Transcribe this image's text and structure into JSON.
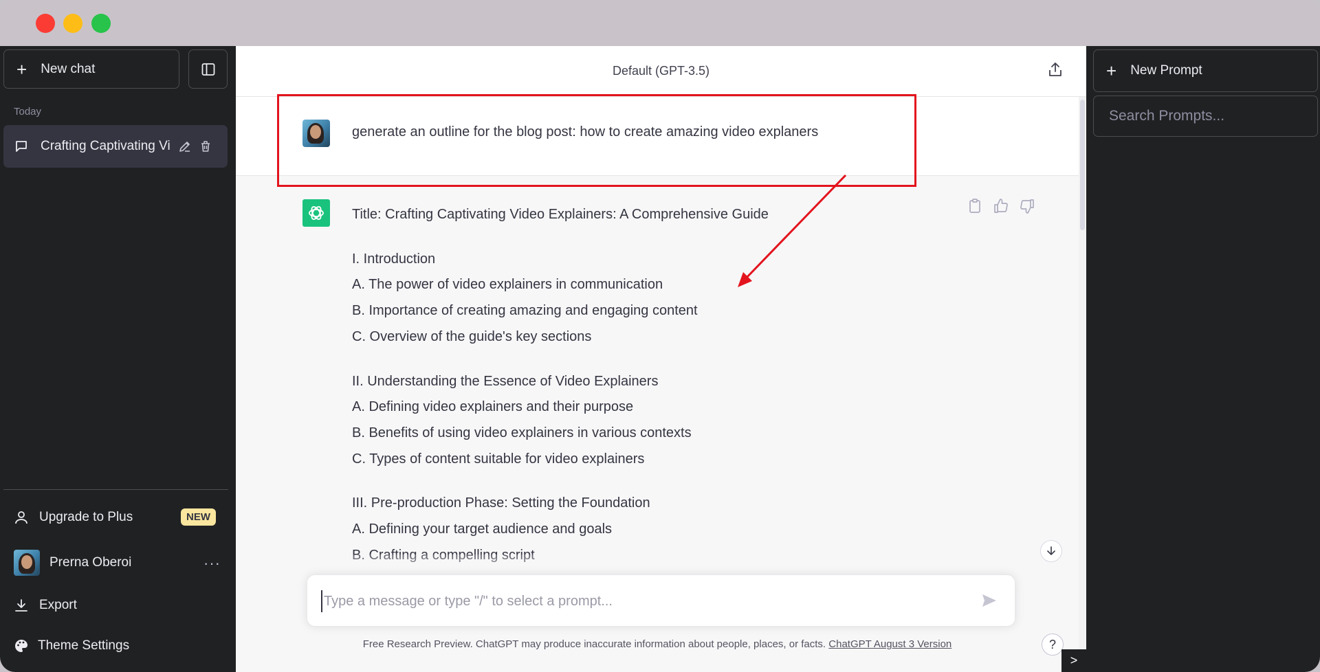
{
  "window": {
    "traffic_lights": [
      "close",
      "minimize",
      "maximize"
    ]
  },
  "sidebar": {
    "new_chat_label": "New chat",
    "section_today": "Today",
    "chat_items": [
      {
        "label": "Crafting Captivating Vi"
      }
    ],
    "upgrade_label": "Upgrade to Plus",
    "new_badge": "NEW",
    "user_name": "Prerna Oberoi",
    "more_label": "···",
    "export_label": "Export",
    "theme_label": "Theme Settings"
  },
  "header": {
    "model_title": "Default (GPT-3.5)"
  },
  "conversation": {
    "user_message": "generate an outline for the blog post: how to create amazing video explaners",
    "assistant_title": "Title: Crafting Captivating Video Explainers: A Comprehensive Guide",
    "sections": [
      {
        "heading": "I. Introduction",
        "items": [
          "A. The power of video explainers in communication",
          "B. Importance of creating amazing and engaging content",
          "C. Overview of the guide's key sections"
        ]
      },
      {
        "heading": "II. Understanding the Essence of Video Explainers",
        "items": [
          "A. Defining video explainers and their purpose",
          "B. Benefits of using video explainers in various contexts",
          "C. Types of content suitable for video explainers"
        ]
      },
      {
        "heading": "III. Pre-production Phase: Setting the Foundation",
        "items": [
          "A. Defining your target audience and goals",
          "B. Crafting a compelling script"
        ]
      }
    ]
  },
  "composer": {
    "placeholder": "Type a message or type \"/\" to select a prompt...",
    "value": ""
  },
  "footer": {
    "note": "Free Research Preview. ChatGPT may produce inaccurate information about people, places, or facts. ",
    "version_link": "ChatGPT August 3 Version",
    "help_label": "?",
    "expand_label": ">"
  },
  "right_panel": {
    "new_prompt_label": "New Prompt",
    "search_placeholder": "Search Prompts..."
  },
  "colors": {
    "sidebar_bg": "#202123",
    "gpt_green": "#19c37d",
    "annotation_red": "#e3141d",
    "badge_yellow": "#fae69e"
  }
}
